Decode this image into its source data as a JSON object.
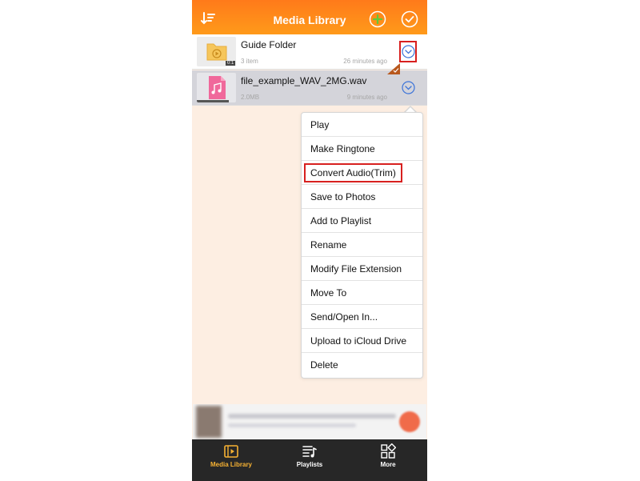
{
  "header": {
    "title": "Media Library",
    "sort_icon": "sort-icon",
    "add_icon": "add-circle-icon",
    "select_icon": "check-circle-icon",
    "accent_color": "#ff8a1a"
  },
  "list": {
    "items": [
      {
        "name": "Guide Folder",
        "meta": "3 item",
        "time": "26 minutes ago",
        "icon": "folder-play-icon"
      },
      {
        "name": "file_example_WAV_2MG.wav",
        "meta": "2.0MB",
        "time": "9 minutes ago",
        "icon": "music-file-icon",
        "duration": "0:1"
      }
    ]
  },
  "menu": {
    "items": [
      "Play",
      "Make Ringtone",
      "Convert Audio(Trim)",
      "Save to Photos",
      "Add to Playlist",
      "Rename",
      "Modify File Extension",
      "Move To",
      "Send/Open In...",
      "Upload to iCloud Drive",
      "Delete"
    ],
    "highlight_color": "#d8201f"
  },
  "tabbar": {
    "tabs": [
      {
        "label": "Media Library",
        "icon": "media-library-icon",
        "active": true
      },
      {
        "label": "Playlists",
        "icon": "playlists-icon",
        "active": false
      },
      {
        "label": "More",
        "icon": "grid-icon",
        "active": false
      }
    ],
    "active_color": "#f7b233"
  }
}
